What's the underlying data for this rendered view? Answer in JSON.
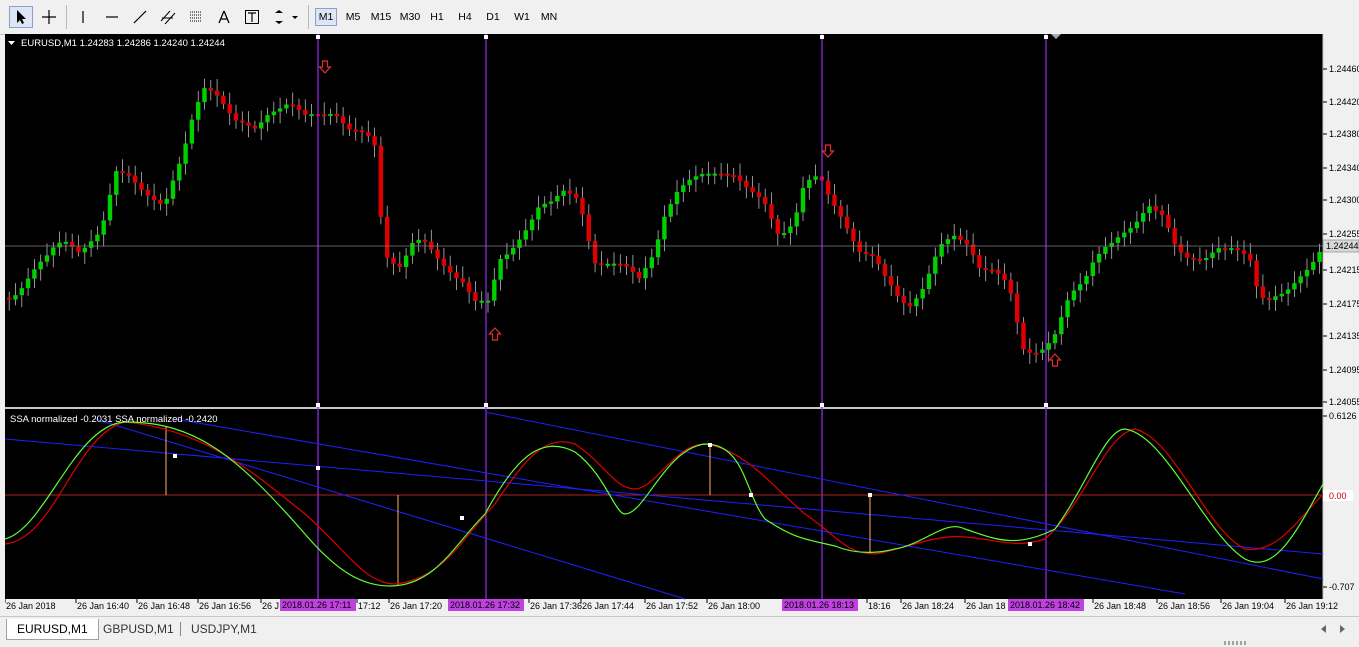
{
  "toolbar": {
    "timeframes": [
      {
        "label": "M1",
        "active": true
      },
      {
        "label": "M5",
        "active": false
      },
      {
        "label": "M15",
        "active": false
      },
      {
        "label": "M30",
        "active": false
      },
      {
        "label": "H1",
        "active": false
      },
      {
        "label": "H4",
        "active": false
      },
      {
        "label": "D1",
        "active": false
      },
      {
        "label": "W1",
        "active": false
      },
      {
        "label": "MN",
        "active": false
      }
    ]
  },
  "main_chart": {
    "header": "EURUSD,M1  1.24283 1.24286 1.24240 1.24244",
    "price_labels": [
      "1.24460",
      "1.24420",
      "1.24380",
      "1.24340",
      "1.24300",
      "1.24255",
      "1.24215",
      "1.24175",
      "1.24135",
      "1.24095",
      "1.24055"
    ],
    "current_price": "1.24244",
    "colors": {
      "bull": "#00d000",
      "bear": "#e00000",
      "background": "#000000",
      "vline": "#8a2be2",
      "signal": "#e03030"
    }
  },
  "indicator": {
    "header": "SSA normalized -0.2031  SSA normalized -0.2420",
    "scale_labels": [
      "0.6126",
      "0.00",
      "-0.707"
    ],
    "colors": {
      "fast": "#60ff30",
      "slow": "#e00000",
      "channel": "#2020ff",
      "zero": "#b02020",
      "marker": "#ffb060"
    }
  },
  "time_axis": {
    "labels": [
      "26 Jan 2018",
      "26 Jan 16:40",
      "26 Jan 16:48",
      "26 Jan 16:56",
      "26 J",
      "17:12",
      "26 Jan 17:20",
      "26 Jan 17:36",
      "26 Jan 17:44",
      "26 Jan 17:52",
      "26 Jan 18:00",
      "18:16",
      "26 Jan 18:24",
      "26 Jan 18",
      "26 Jan 18:48",
      "26 Jan 18:56",
      "26 Jan 19:04",
      "26 Jan 19:12"
    ],
    "highlights": [
      "2018.01.26 17:11",
      "2018.01.26 17:32",
      "2018.01.26 18:13",
      "2018.01.26 18:42"
    ]
  },
  "tabs": [
    {
      "label": "EURUSD,M1",
      "active": true
    },
    {
      "label": "GBPUSD,M1",
      "active": false
    },
    {
      "label": "USDJPY,M1",
      "active": false
    }
  ]
}
